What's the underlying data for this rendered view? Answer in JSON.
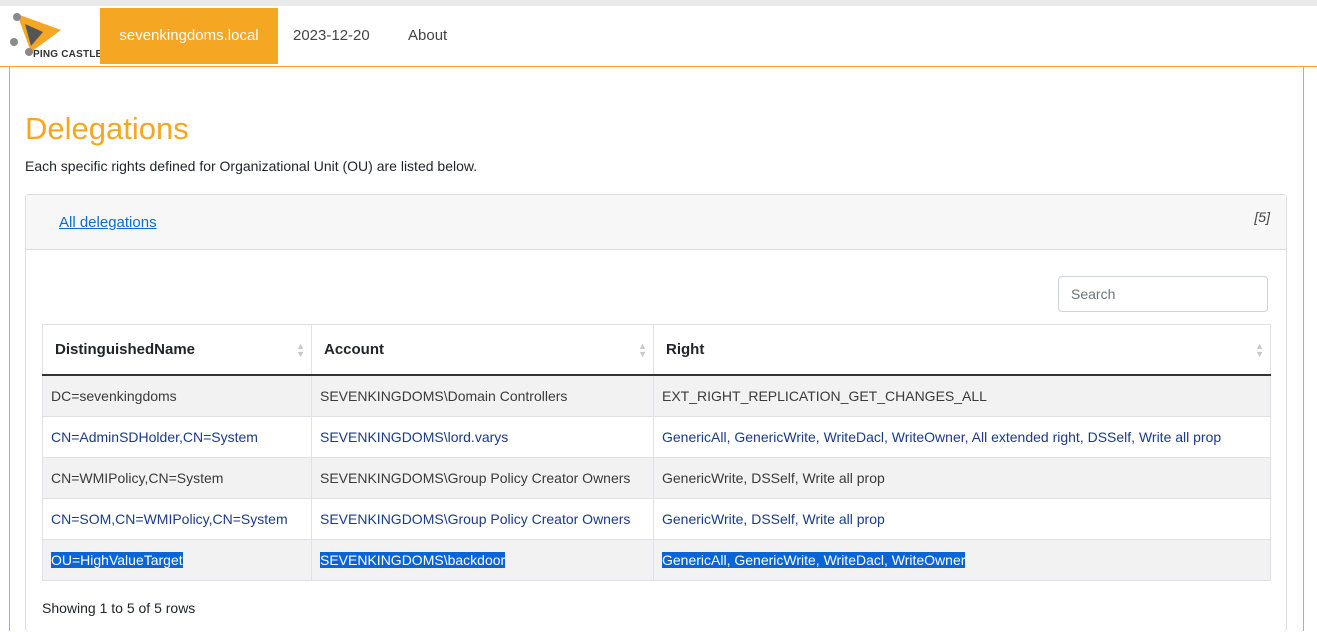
{
  "brand": {
    "logo_text": "PING CASTLE"
  },
  "nav": {
    "domain": "sevenkingdoms.local",
    "date": "2023-12-20",
    "about": "About"
  },
  "page": {
    "title": "Delegations",
    "description": "Each specific rights defined for Organizational Unit (OU) are listed below."
  },
  "card": {
    "link": "All delegations",
    "count": "[5]"
  },
  "search": {
    "placeholder": "Search"
  },
  "table": {
    "headers": [
      "DistinguishedName",
      "Account",
      "Right"
    ],
    "rows": [
      [
        "DC=sevenkingdoms",
        "SEVENKINGDOMS\\Domain Controllers",
        "EXT_RIGHT_REPLICATION_GET_CHANGES_ALL"
      ],
      [
        "CN=AdminSDHolder,CN=System",
        "SEVENKINGDOMS\\lord.varys",
        "GenericAll, GenericWrite, WriteDacl, WriteOwner, All extended right, DSSelf, Write all prop"
      ],
      [
        "CN=WMIPolicy,CN=System",
        "SEVENKINGDOMS\\Group Policy Creator Owners",
        "GenericWrite, DSSelf, Write all prop"
      ],
      [
        "CN=SOM,CN=WMIPolicy,CN=System",
        "SEVENKINGDOMS\\Group Policy Creator Owners",
        "GenericWrite, DSSelf, Write all prop"
      ],
      [
        "OU=HighValueTarget",
        "SEVENKINGDOMS\\backdoor",
        "GenericAll, GenericWrite, WriteDacl, WriteOwner"
      ]
    ],
    "footer": "Showing 1 to 5 of 5 rows"
  },
  "colors": {
    "accent": "#f5a623",
    "link": "#0b6bd3",
    "selection": "#0a64d6"
  }
}
